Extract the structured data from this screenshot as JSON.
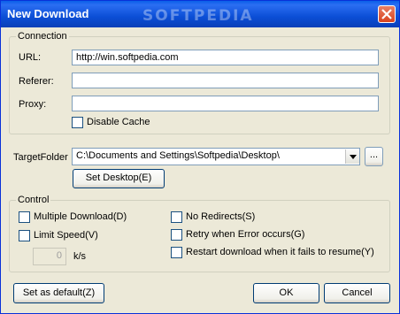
{
  "window": {
    "title": "New Download",
    "watermark": "SOFTPEDIA"
  },
  "connection": {
    "legend": "Connection",
    "url_label": "URL:",
    "url_value": "http://win.softpedia.com",
    "referer_label": "Referer:",
    "referer_value": "",
    "proxy_label": "Proxy:",
    "proxy_value": "",
    "disable_cache_label": "Disable Cache"
  },
  "target": {
    "label": "TargetFolder",
    "value": "C:\\Documents and Settings\\Softpedia\\Desktop\\",
    "browse_label": "...",
    "set_desktop_label": "Set Desktop(E)"
  },
  "control": {
    "legend": "Control",
    "multiple_download": "Multiple Download(D)",
    "limit_speed": "Limit Speed(V)",
    "speed_value": "0",
    "speed_unit": "k/s",
    "no_redirects": "No Redirects(S)",
    "retry_on_error": "Retry when Error occurs(G)",
    "restart_download": "Restart download when it fails to resume(Y)"
  },
  "buttons": {
    "set_default": "Set as default(Z)",
    "ok": "OK",
    "cancel": "Cancel"
  },
  "colors": {
    "titlebar": "#0a5fe8",
    "face": "#ece9d8",
    "field_border": "#7f9db9",
    "close": "#d9431e"
  }
}
